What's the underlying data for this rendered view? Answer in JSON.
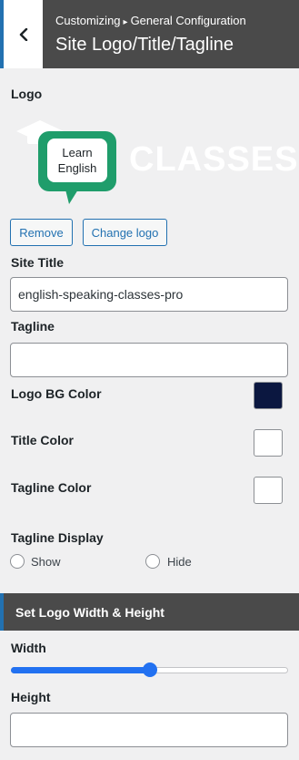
{
  "header": {
    "breadcrumb_parent": "Customizing",
    "breadcrumb_sep": "▸",
    "breadcrumb_child": "General Configuration",
    "title": "Site Logo/Title/Tagline"
  },
  "logo": {
    "label": "Logo",
    "image_line1": "Learn",
    "image_line2": "English",
    "image_word": "CLASSES",
    "remove_label": "Remove",
    "change_label": "Change logo"
  },
  "site_title": {
    "label": "Site Title",
    "value": "english-speaking-classes-pro"
  },
  "tagline": {
    "label": "Tagline",
    "value": ""
  },
  "colors": {
    "logo_bg": {
      "label": "Logo BG Color",
      "value": "#0b1740"
    },
    "title": {
      "label": "Title Color",
      "value": "#ffffff"
    },
    "tagline": {
      "label": "Tagline Color",
      "value": "#ffffff"
    },
    "accent": "#2271b1",
    "logo_green": "#1f9d6b"
  },
  "tagline_display": {
    "label": "Tagline Display",
    "options": [
      "Show",
      "Hide"
    ],
    "selected": ""
  },
  "logo_size_section": {
    "title": "Set Logo Width & Height",
    "width_label": "Width",
    "width_level": 0.5,
    "height_label": "Height",
    "height_value": ""
  }
}
